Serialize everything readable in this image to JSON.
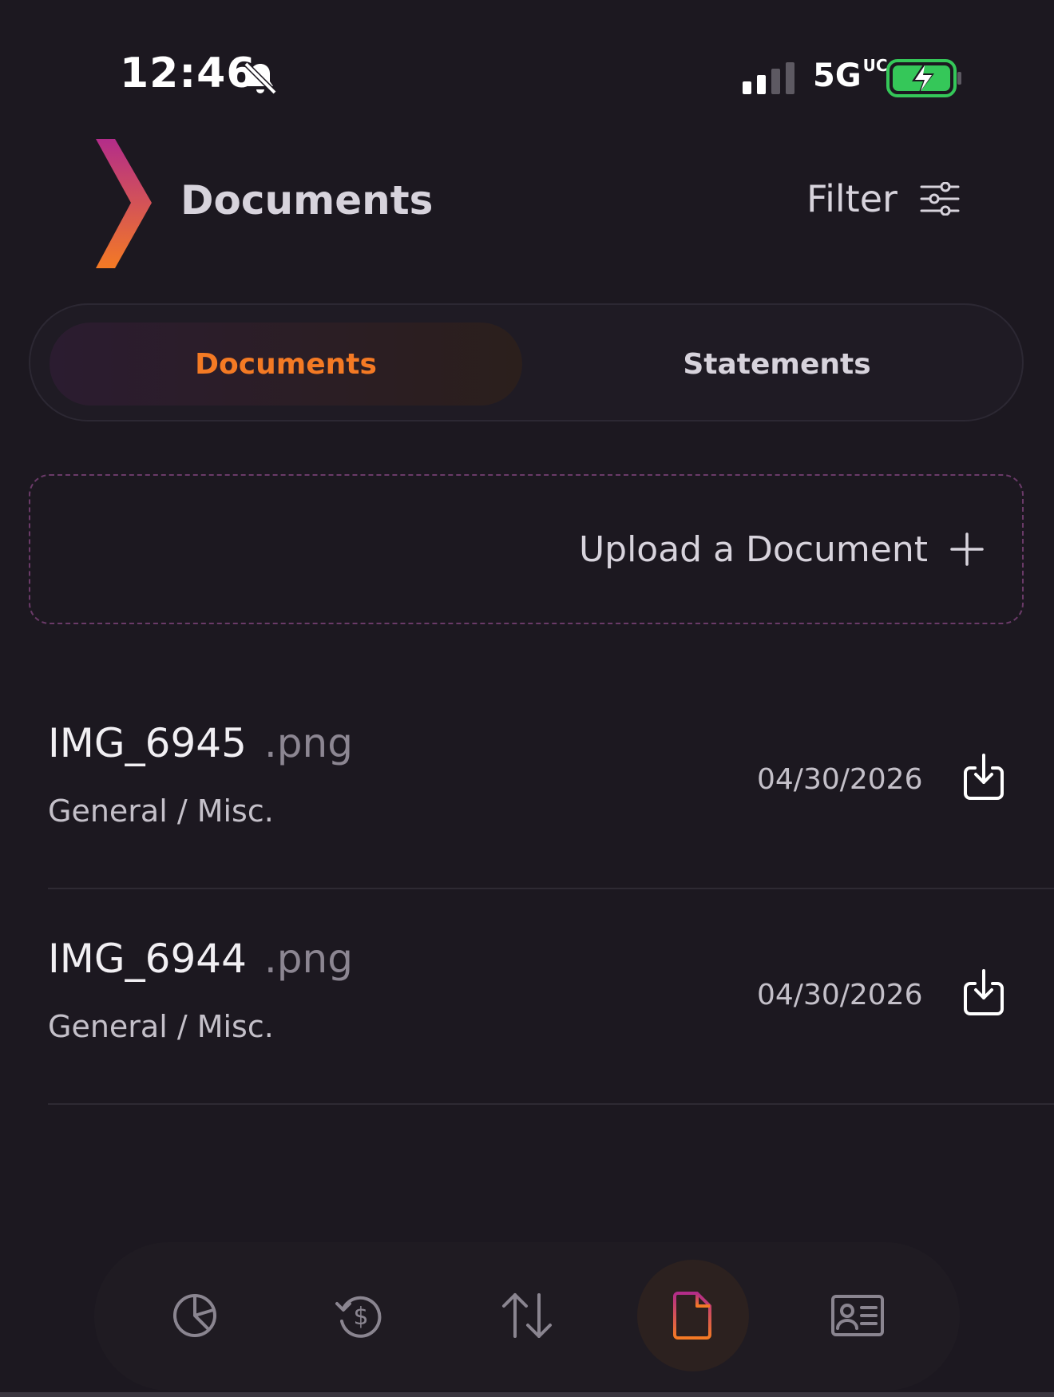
{
  "status_bar": {
    "time": "12:46",
    "network": "5G",
    "network_suffix": "UC"
  },
  "header": {
    "title": "Documents",
    "filter_label": "Filter"
  },
  "tabs": [
    {
      "label": "Documents",
      "active": true
    },
    {
      "label": "Statements",
      "active": false
    }
  ],
  "upload": {
    "label": "Upload a Document"
  },
  "documents": [
    {
      "name": "IMG_6945",
      "ext": ".png",
      "category": "General / Misc.",
      "date": "04/30/2026"
    },
    {
      "name": "IMG_6944",
      "ext": ".png",
      "category": "General / Misc.",
      "date": "04/30/2026"
    }
  ],
  "nav": {
    "items": [
      "portfolio-icon",
      "recurring-payment-icon",
      "transfers-icon",
      "documents-icon",
      "profile-card-icon"
    ],
    "active_index": 3
  },
  "colors": {
    "background": "#1c1820",
    "accent": "#f47a24",
    "accent_purple": "#b32c8a",
    "battery_green": "#35c759"
  }
}
